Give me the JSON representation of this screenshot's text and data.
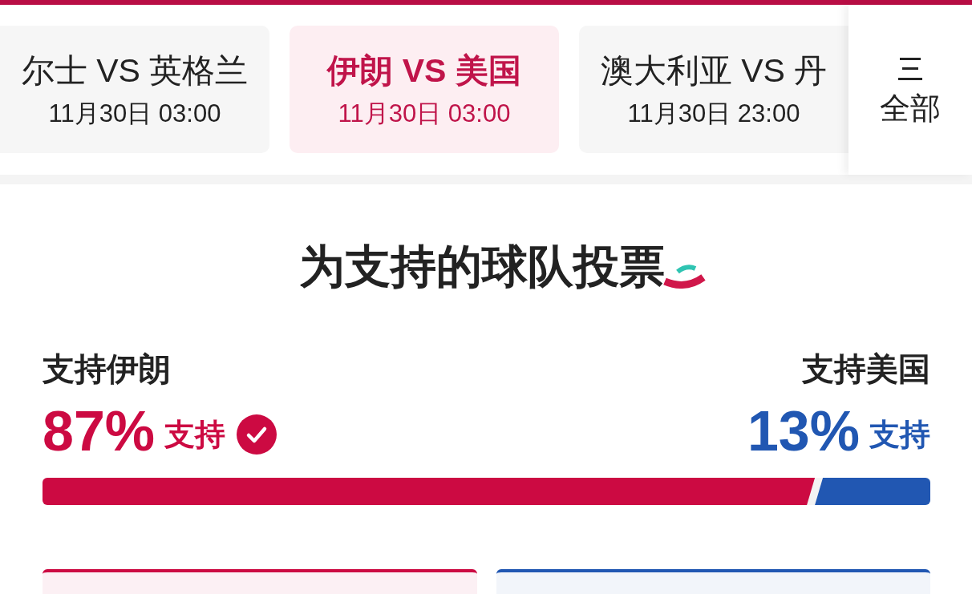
{
  "matches": [
    {
      "title": "尔士 VS 英格兰",
      "date": "11月30日 03:00",
      "selected": false
    },
    {
      "title": "伊朗 VS 美国",
      "date": "11月30日 03:00",
      "selected": true
    },
    {
      "title": "澳大利亚 VS 丹",
      "date": "11月30日 23:00",
      "selected": false
    }
  ],
  "all_button": {
    "label": "全部"
  },
  "vote": {
    "title": "为支持的球队投票",
    "options": [
      {
        "label": "支持伊朗",
        "percent": "87%",
        "suffix": "支持",
        "voted": true,
        "level": 0.87,
        "color": "#cc0a42"
      },
      {
        "label": "支持美国",
        "percent": "13%",
        "suffix": "支持",
        "voted": false,
        "level": 0.13,
        "color": "#2157b2"
      }
    ]
  }
}
